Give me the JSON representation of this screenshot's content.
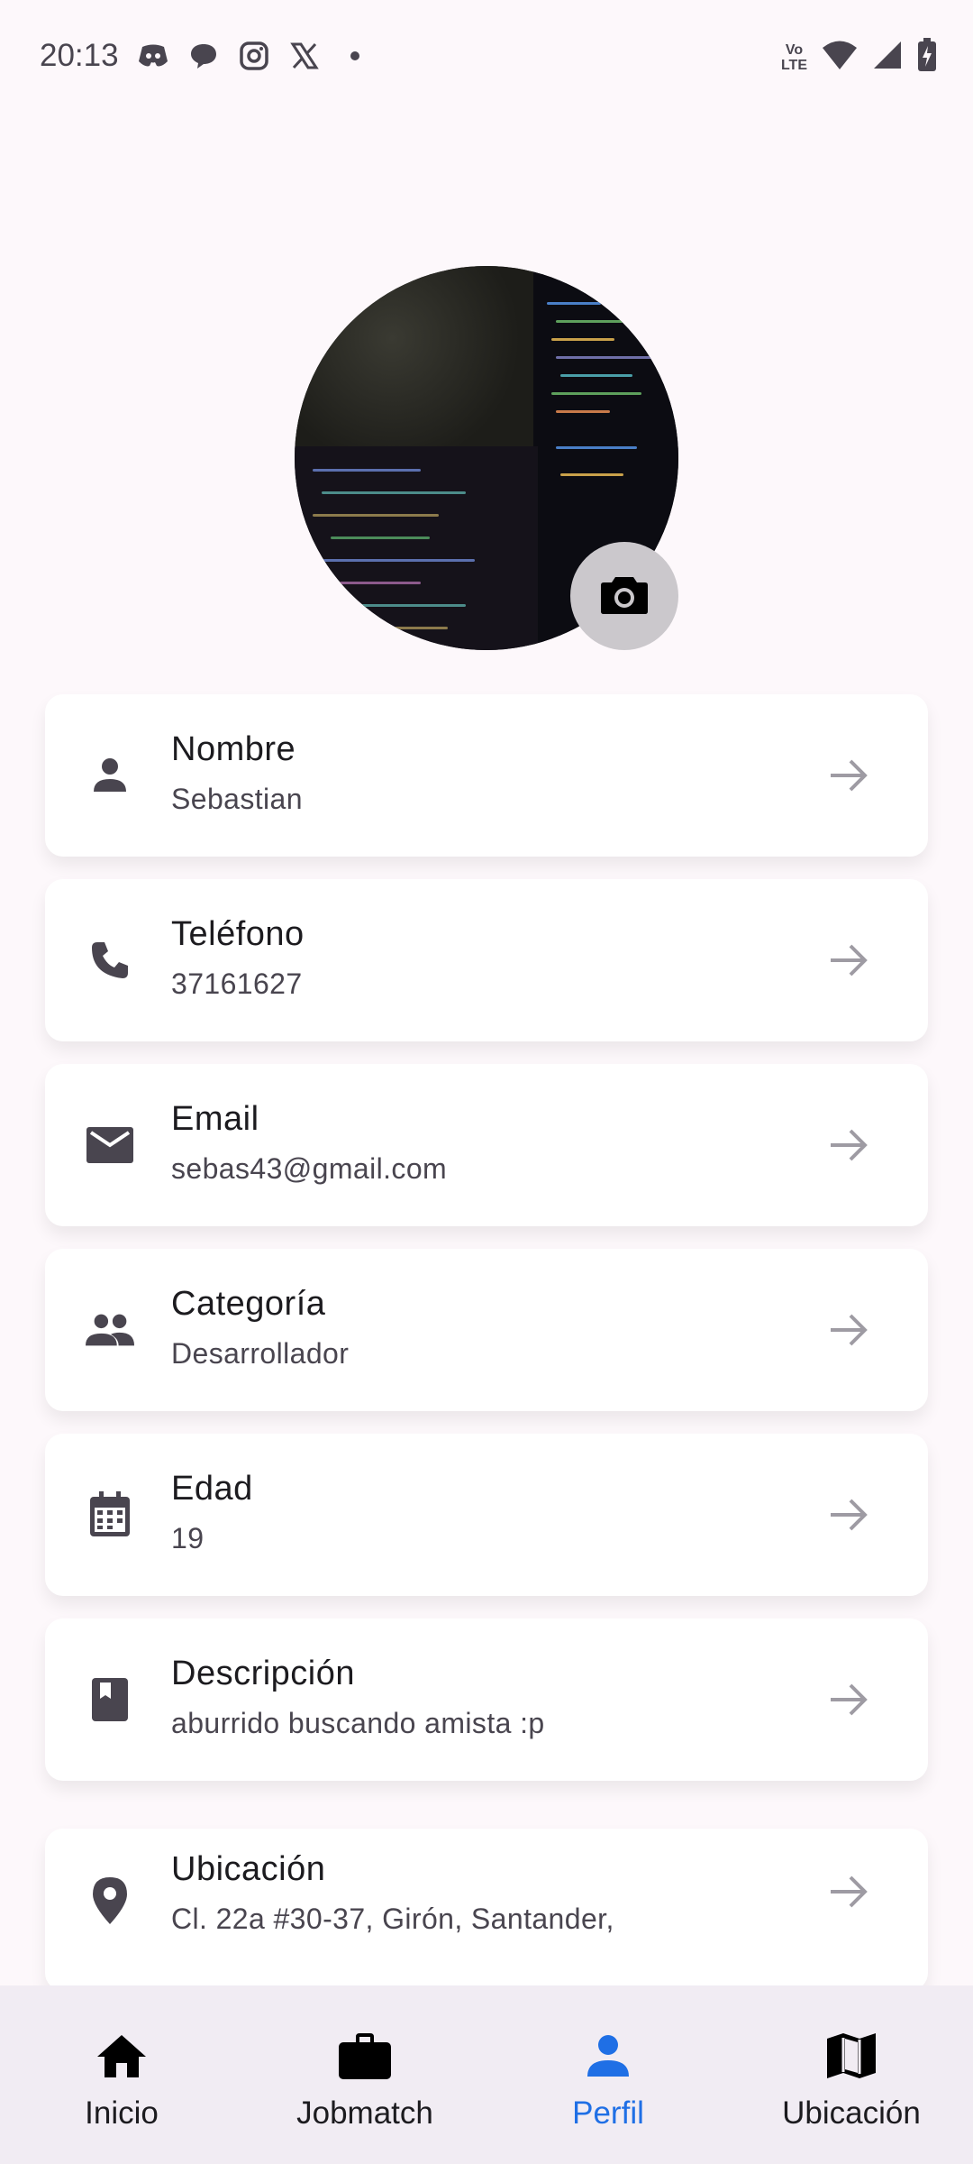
{
  "status_bar": {
    "time": "20:13",
    "notification_icons": [
      "discord-icon",
      "chat-icon",
      "instagram-icon",
      "x-icon",
      "dot-icon"
    ],
    "network_label_top": "Vo",
    "network_label_bottom": "LTE"
  },
  "profile": {
    "avatar_alt": "profile-photo",
    "change_photo_icon": "camera-icon"
  },
  "fields": [
    {
      "icon": "person-icon",
      "title": "Nombre",
      "value": "Sebastian"
    },
    {
      "icon": "phone-icon",
      "title": "Teléfono",
      "value": "37161627"
    },
    {
      "icon": "email-icon",
      "title": "Email",
      "value": "sebas43@gmail.com"
    },
    {
      "icon": "group-icon",
      "title": "Categoría",
      "value": "Desarrollador"
    },
    {
      "icon": "calendar-icon",
      "title": "Edad",
      "value": "19"
    },
    {
      "icon": "book-icon",
      "title": "Descripción",
      "value": "aburrido buscando amista :p"
    },
    {
      "icon": "location-pin-icon",
      "title": "Ubicación",
      "value": "Cl. 22a #30-37, Girón, Santander,"
    }
  ],
  "bottom_nav": {
    "items": [
      {
        "label": "Inicio",
        "icon": "home-icon"
      },
      {
        "label": "Jobmatch",
        "icon": "briefcase-icon"
      },
      {
        "label": "Perfil",
        "icon": "person-icon",
        "active": true
      },
      {
        "label": "Ubicación",
        "icon": "map-icon"
      }
    ]
  },
  "colors": {
    "background": "#fdf8fb",
    "card": "#ffffff",
    "accent": "#1f6fe5",
    "nav_background": "#f1ecf3"
  }
}
